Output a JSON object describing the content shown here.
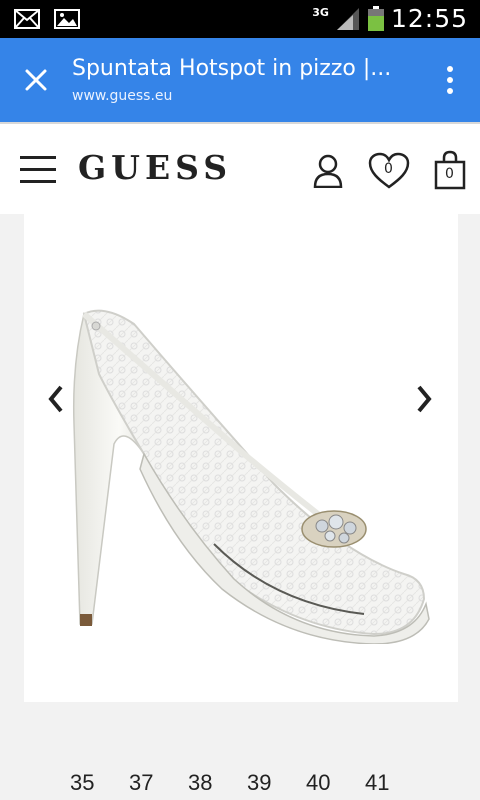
{
  "status_bar": {
    "network": "3G",
    "time": "12:55",
    "icons": [
      "mail-icon",
      "image-icon",
      "signal-icon",
      "battery-icon"
    ]
  },
  "browser": {
    "title": "Spuntata Hotspot in pizzo |...",
    "url": "www.guess.eu",
    "accent": "#3584e8"
  },
  "site": {
    "logo": "GUESS",
    "wishlist_count": "0",
    "cart_count": "0"
  },
  "sizes": [
    "35",
    "37",
    "38",
    "39",
    "40",
    "41"
  ]
}
